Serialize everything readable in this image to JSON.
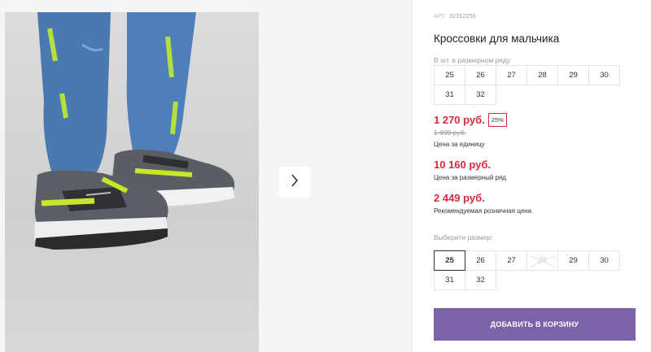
{
  "product": {
    "article_label": "АРТ:",
    "article_number": "32312250",
    "title": "Кроссовки для мальчика"
  },
  "pack": {
    "label": "В шт. в размерном ряду",
    "sizes": [
      "25",
      "26",
      "27",
      "28",
      "29",
      "30",
      "31",
      "32"
    ]
  },
  "prices": {
    "current": "1 270 руб.",
    "discount": "25%",
    "old": "1 690 руб.",
    "unit_note": "Цена за единицу",
    "row_price": "10 160 руб.",
    "row_note": "Цена за размерный ряд",
    "retail_price": "2 449 руб.",
    "retail_note": "Рекомендуемая розничная цена"
  },
  "choose": {
    "label": "Выберите размер:",
    "sizes": [
      {
        "value": "25",
        "state": "selected"
      },
      {
        "value": "26",
        "state": "available"
      },
      {
        "value": "27",
        "state": "available"
      },
      {
        "value": "28",
        "state": "disabled"
      },
      {
        "value": "29",
        "state": "available"
      },
      {
        "value": "30",
        "state": "available"
      },
      {
        "value": "31",
        "state": "available"
      },
      {
        "value": "32",
        "state": "available"
      }
    ]
  },
  "actions": {
    "add_to_cart": "ДОБАВИТЬ В КОРЗИНУ",
    "next_icon": "chevron-right-icon"
  },
  "colors": {
    "price_red": "#d42a3b",
    "button_purple": "#7a63a8"
  }
}
